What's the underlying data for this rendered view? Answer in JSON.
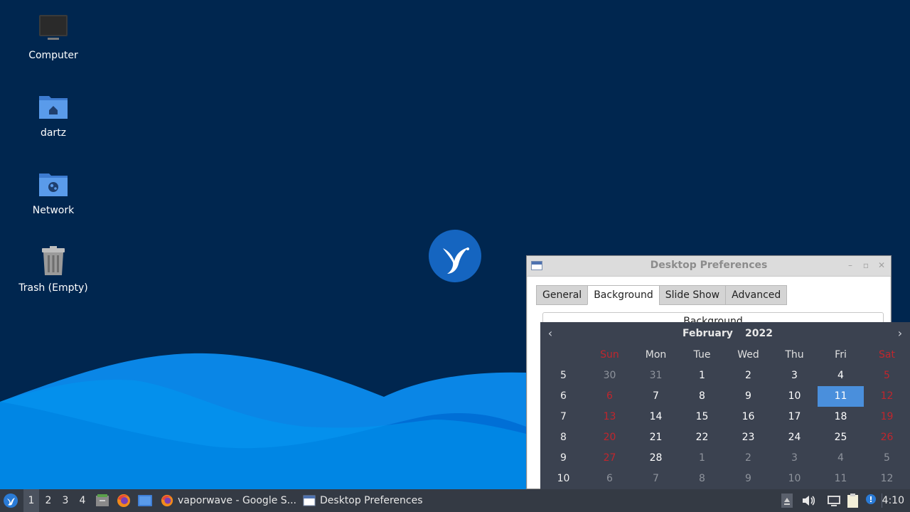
{
  "desktop": {
    "icons": [
      {
        "label": "Computer",
        "icon": "computer-icon"
      },
      {
        "label": "dartz",
        "icon": "home-folder-icon"
      },
      {
        "label": "Network",
        "icon": "network-folder-icon"
      },
      {
        "label": "Trash (Empty)",
        "icon": "trash-icon"
      }
    ]
  },
  "window": {
    "title": "Desktop Preferences",
    "tabs": [
      "General",
      "Background",
      "Slide Show",
      "Advanced"
    ],
    "active_tab": "Background",
    "group_label": "Background"
  },
  "calendar": {
    "month": "February",
    "year": "2022",
    "weekdays": [
      "Sun",
      "Mon",
      "Tue",
      "Wed",
      "Thu",
      "Fri",
      "Sat"
    ],
    "selected_day": "11",
    "rows": [
      {
        "week": "5",
        "days": [
          "30",
          "31",
          "1",
          "2",
          "3",
          "4",
          "5"
        ],
        "other": [
          0,
          1
        ]
      },
      {
        "week": "6",
        "days": [
          "6",
          "7",
          "8",
          "9",
          "10",
          "11",
          "12"
        ],
        "other": []
      },
      {
        "week": "7",
        "days": [
          "13",
          "14",
          "15",
          "16",
          "17",
          "18",
          "19"
        ],
        "other": []
      },
      {
        "week": "8",
        "days": [
          "20",
          "21",
          "22",
          "23",
          "24",
          "25",
          "26"
        ],
        "other": []
      },
      {
        "week": "9",
        "days": [
          "27",
          "28",
          "1",
          "2",
          "3",
          "4",
          "5"
        ],
        "other": [
          2,
          3,
          4,
          5,
          6
        ]
      },
      {
        "week": "10",
        "days": [
          "6",
          "7",
          "8",
          "9",
          "10",
          "11",
          "12"
        ],
        "other": [
          0,
          1,
          2,
          3,
          4,
          5,
          6
        ]
      }
    ]
  },
  "taskbar": {
    "workspaces": [
      "1",
      "2",
      "3",
      "4"
    ],
    "active_workspace": "1",
    "tasks": [
      {
        "label": "vaporwave - Google S...",
        "icon": "firefox-icon"
      },
      {
        "label": "Desktop Preferences",
        "icon": "window-icon"
      }
    ],
    "clock": "4:10"
  },
  "colors": {
    "desktop_bg": "#00264f",
    "wave_light": "#0099f0",
    "wave_dark": "#006fd6",
    "calendar_bg": "#3b4250",
    "weekend": "#c0262d",
    "selected": "#4a8fdc",
    "taskbar_bg": "#343a44"
  }
}
